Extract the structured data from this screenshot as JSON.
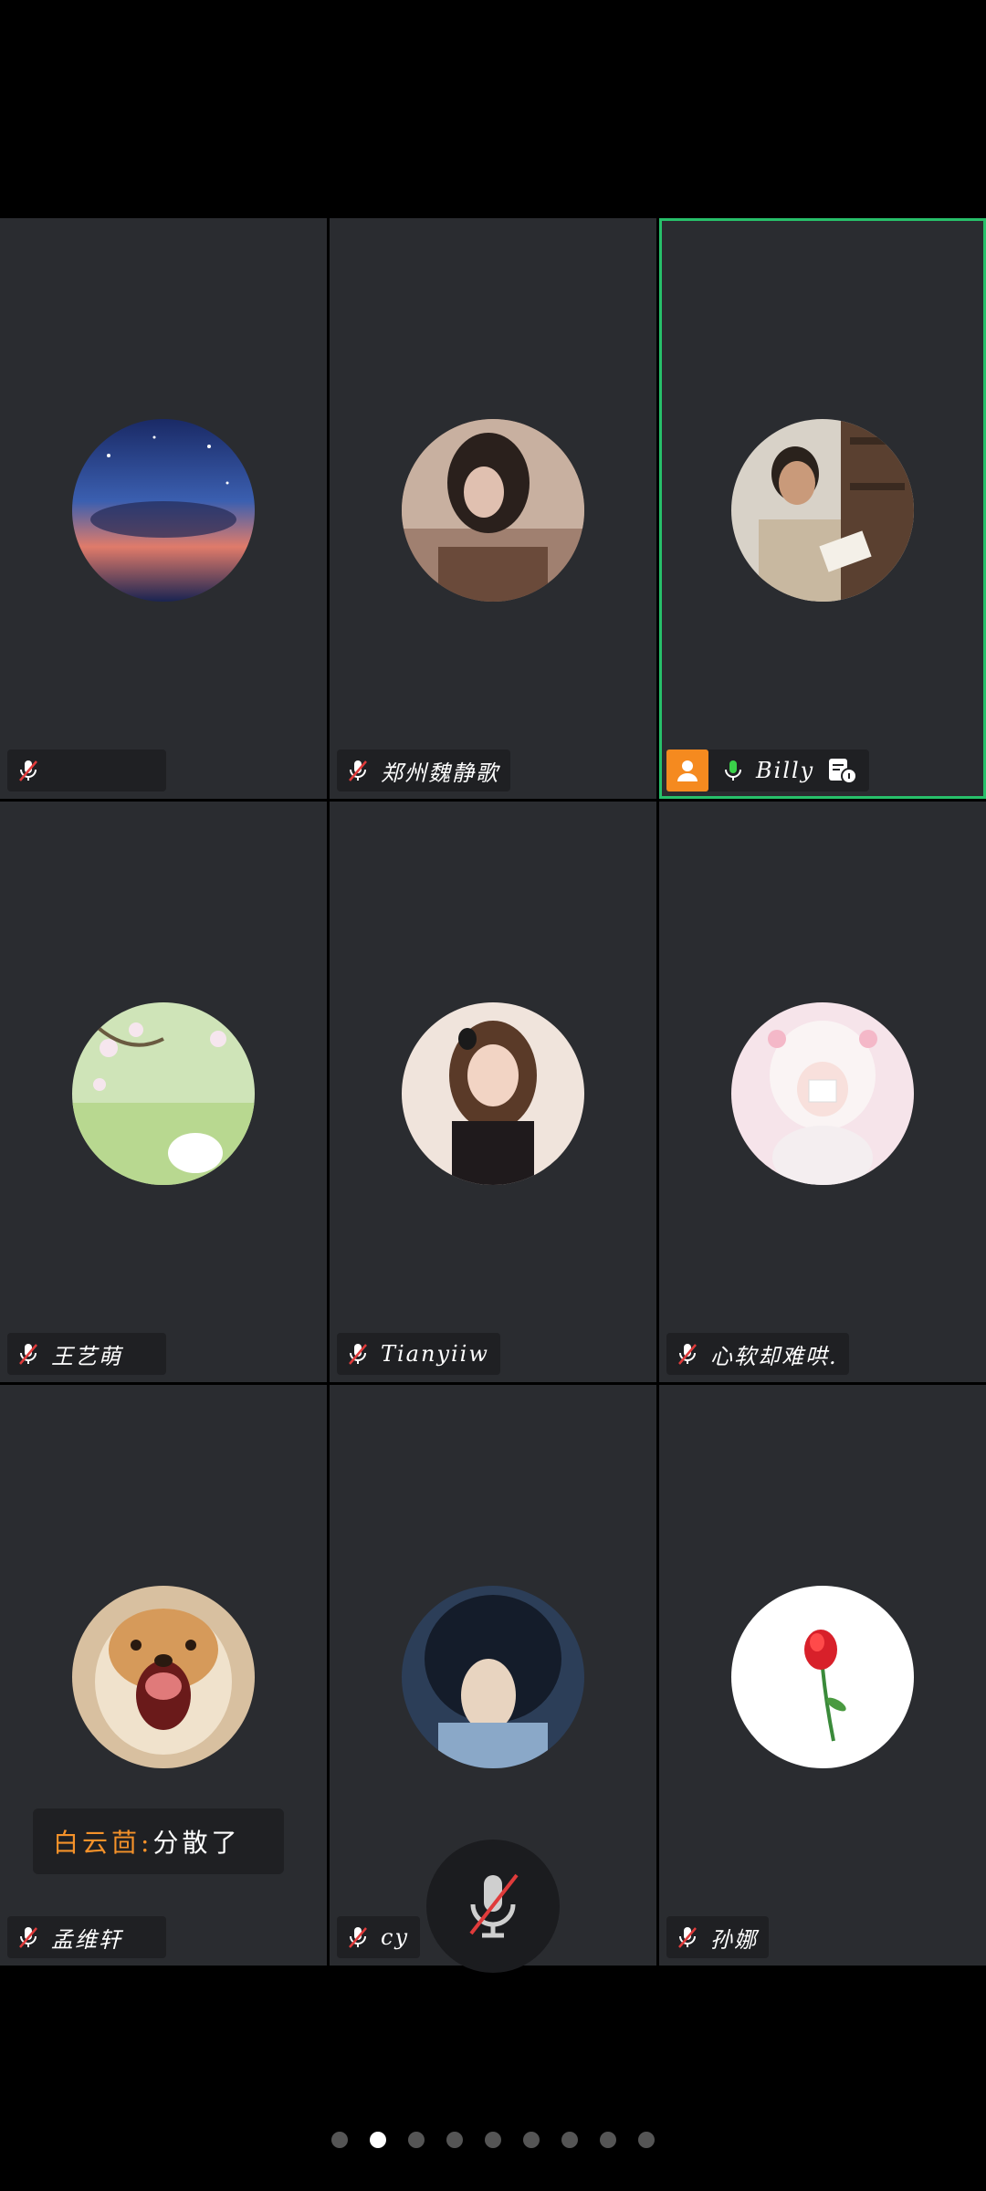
{
  "participants": [
    {
      "name": "",
      "mic": "muted"
    },
    {
      "name": "郑州魏静歌",
      "mic": "muted"
    },
    {
      "name": "Billy",
      "mic": "on",
      "host": true,
      "active_speaker": true
    },
    {
      "name": "王艺萌",
      "mic": "muted"
    },
    {
      "name": "Tianyiiw",
      "mic": "muted"
    },
    {
      "name": "心软却难哄.",
      "mic": "muted"
    },
    {
      "name": "孟维轩",
      "mic": "muted"
    },
    {
      "name": "cy",
      "mic": "muted"
    },
    {
      "name": "孙娜",
      "mic": "muted"
    }
  ],
  "chat": {
    "sender": "白云茴:",
    "message": " 分散了"
  },
  "controls": {
    "mute_button_icon": "mic-off-icon"
  },
  "pager": {
    "total_pages": 9,
    "current_page": 2
  },
  "colors": {
    "active_border": "#27c06a",
    "host_badge": "#f58a1f",
    "mic_on": "#3ad14a",
    "mic_muted_slash": "#e03b3b",
    "chat_sender": "#f5922a"
  }
}
